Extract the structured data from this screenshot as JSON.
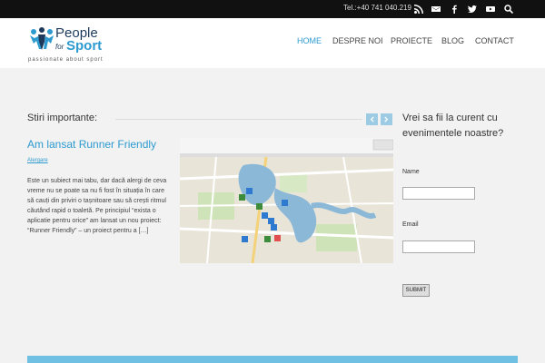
{
  "topbar": {
    "phone": "Tel.:+40 741 040.219",
    "icons": [
      "rss-icon",
      "mail-icon",
      "facebook-icon",
      "twitter-icon",
      "youtube-icon",
      "search-icon"
    ]
  },
  "logo": {
    "people": "People",
    "for": "for",
    "sport": "Sport",
    "tagline": "passionate about sport"
  },
  "nav": {
    "items": [
      {
        "label": "HOME",
        "active": true
      },
      {
        "label": "DESPRE NOI",
        "active": false
      },
      {
        "label": "PROIECTE",
        "active": false
      },
      {
        "label": "BLOG",
        "active": false
      },
      {
        "label": "CONTACT",
        "active": false
      }
    ]
  },
  "main": {
    "section_title": "Stiri importante:",
    "post": {
      "title": "Am lansat Runner Friendly",
      "category": "Alergare",
      "excerpt": "Este un subiect mai tabu, dar dacă alergi de ceva vreme nu se poate sa nu fi fost în situația în care să cauți din priviri o tașnitoare sau să crești ritmul căutând rapid o toaletă. Pe principiul “exista o aplicatie pentru orice” am lansat un nou proiect: “Runner Friendly” – un proiect pentru a […]"
    }
  },
  "sidebar": {
    "title": "Vrei sa fii la curent cu evenimentele noastre?",
    "name_label": "Name",
    "email_label": "Email",
    "submit_label": "SUBMIT"
  },
  "colors": {
    "accent": "#2d9ad0",
    "topbar": "#111111",
    "footer_bar": "#6fc0e3"
  }
}
